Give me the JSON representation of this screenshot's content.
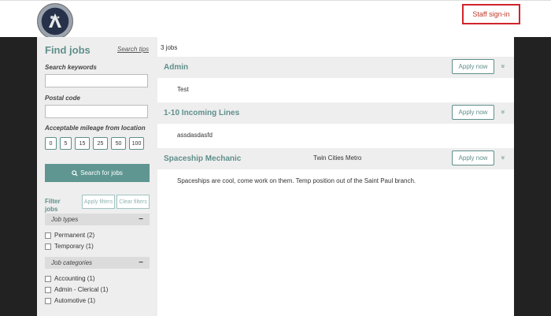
{
  "header": {
    "logo_icon": "eagle-seal-logo",
    "staff_signin": "Staff sign-in"
  },
  "sidebar": {
    "title": "Find jobs",
    "search_tips": "Search tips",
    "keywords_label": "Search keywords",
    "postal_label": "Postal code",
    "mileage_label": "Acceptable mileage from location",
    "mileage_options": [
      "0",
      "5",
      "15",
      "25",
      "50",
      "100"
    ],
    "search_button": "Search for jobs",
    "search_icon": "search-icon",
    "filter_title": "Filter jobs",
    "apply_filters": "Apply filters",
    "clear_filters": "Clear filters",
    "job_types": {
      "title": "Job types",
      "items": [
        "Permanent (2)",
        "Temporary (1)"
      ]
    },
    "job_categories": {
      "title": "Job categories",
      "items": [
        "Accounting (1)",
        "Admin - Clerical (1)",
        "Automotive (1)"
      ]
    }
  },
  "main": {
    "count": "3 jobs",
    "apply_label": "Apply now",
    "jobs": [
      {
        "title": "Admin",
        "location": "",
        "description": "Test"
      },
      {
        "title": "1-10 Incoming Lines",
        "location": "",
        "description": "assdasdasfd"
      },
      {
        "title": "Spaceship Mechanic",
        "location": "Twin Cities Metro",
        "description": "Spaceships are cool, come work on them. Temp position out of the Saint Paul branch."
      }
    ]
  },
  "colors": {
    "accent": "#5f8f8b",
    "highlight_border": "#d0242b",
    "frame": "#222222"
  }
}
